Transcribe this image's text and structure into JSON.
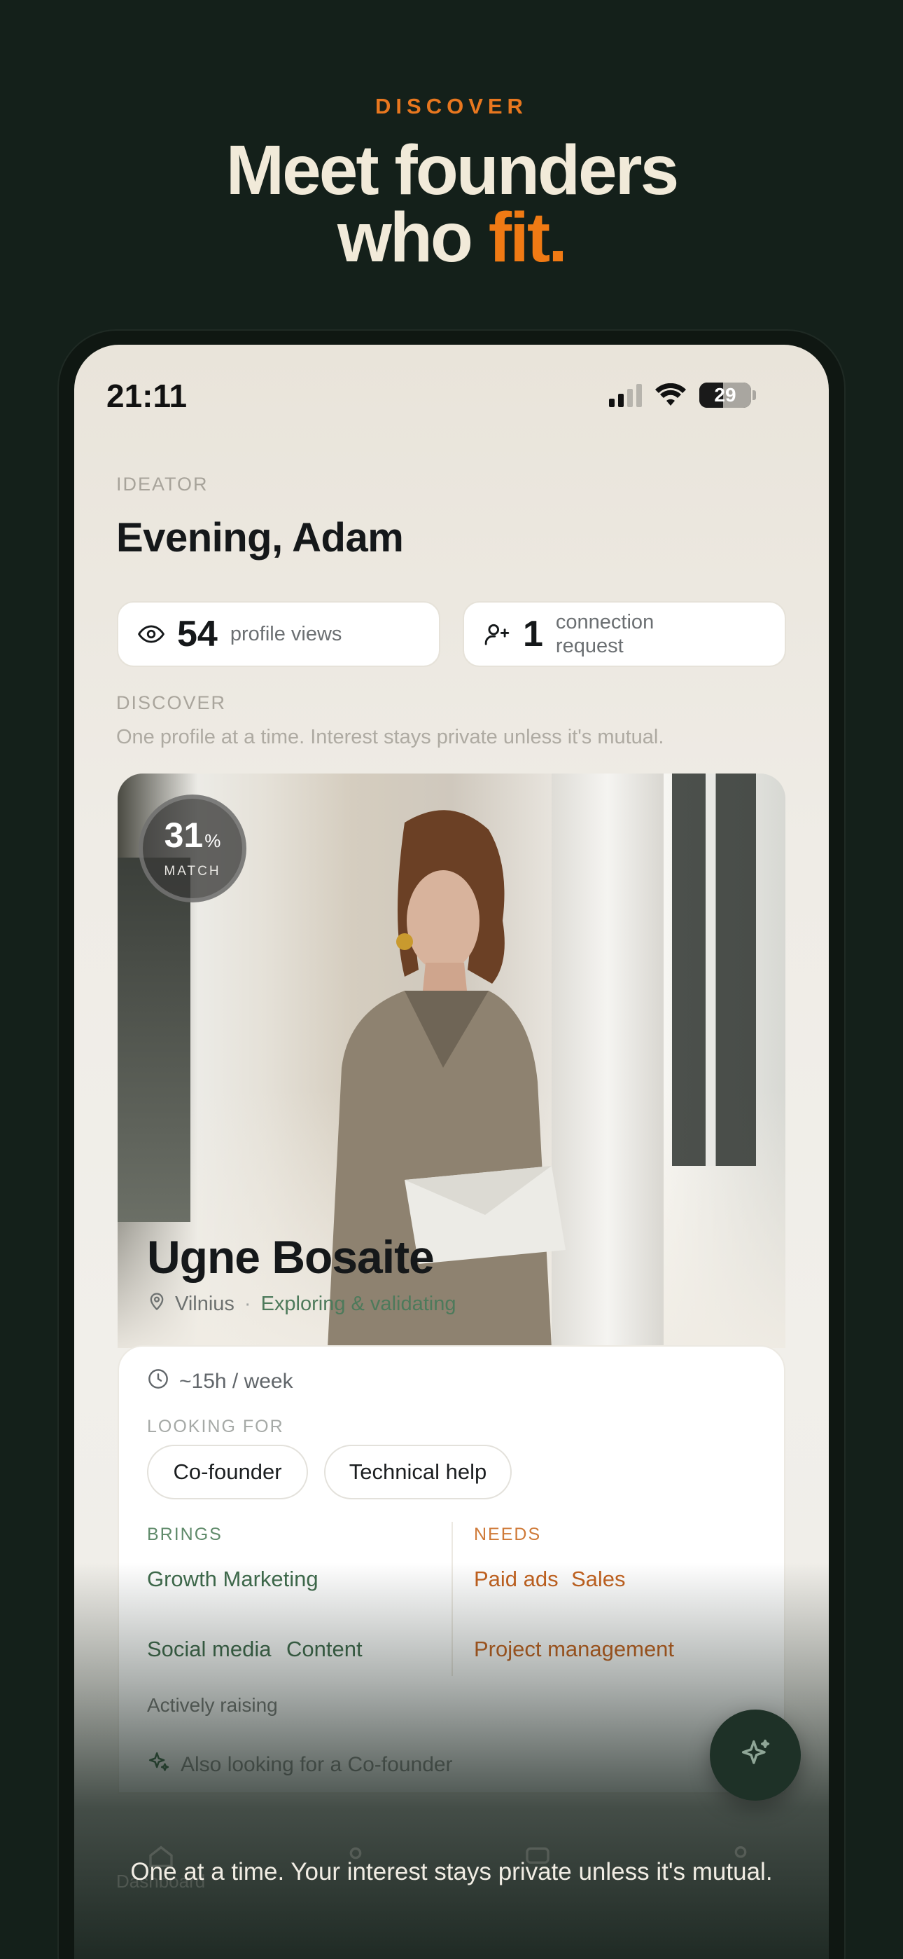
{
  "marketing": {
    "kicker": "DISCOVER",
    "headline_line1": "Meet founders",
    "headline_line2_prefix": "who ",
    "headline_line2_accent": "fit.",
    "caption": "One at a time. Your interest stays private unless it's mutual."
  },
  "status_bar": {
    "time": "21:11",
    "battery": "29"
  },
  "header": {
    "role": "IDEATOR",
    "greeting": "Evening, Adam"
  },
  "stats": {
    "views_count": "54",
    "views_label": "profile views",
    "requests_count": "1",
    "requests_label_line1": "connection",
    "requests_label_line2": "request"
  },
  "discover": {
    "label": "DISCOVER",
    "subtitle": "One profile at a time. Interest stays private unless it's mutual."
  },
  "profile": {
    "match_percent": "31",
    "match_percent_sign": "%",
    "match_label": "MATCH",
    "name": "Ugne Bosaite",
    "city": "Vilnius",
    "separator": "·",
    "stage": "Exploring & validating",
    "hours": "~15h / week",
    "looking_for_label": "LOOKING FOR",
    "looking_for": [
      "Co-founder",
      "Technical help"
    ],
    "brings_label": "BRINGS",
    "brings": [
      "Growth Marketing",
      "Social media",
      "Content"
    ],
    "needs_label": "NEEDS",
    "needs": [
      "Paid ads",
      "Sales",
      "Project management"
    ],
    "raising": "Actively raising",
    "also_looking": "Also looking for a Co-founder"
  },
  "tabbar": {
    "tabs": [
      "Dashboard",
      "",
      "",
      ""
    ]
  },
  "colors": {
    "background": "#14201a",
    "accent_orange": "#f07a14",
    "headline": "#f1ead9",
    "green_text": "#3f6b4c",
    "orange_text": "#c3621f"
  },
  "icons": [
    "eye-icon",
    "add-user-icon",
    "map-pin-icon",
    "clock-icon",
    "sparkle-icon",
    "wifi-icon",
    "signal-icon",
    "battery-icon"
  ]
}
